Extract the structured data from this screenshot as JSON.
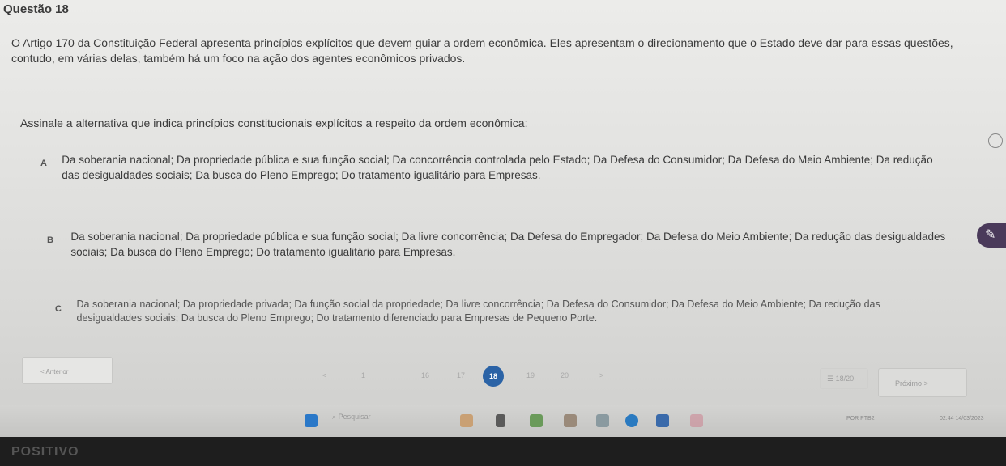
{
  "question": {
    "title": "Questão 18",
    "statement": "O Artigo 170 da Constituição Federal apresenta princípios explícitos que devem guiar a ordem econômica. Eles apresentam o direcionamento que o Estado deve dar para essas questões, contudo, em várias delas, também há um foco na ação dos agentes econômicos privados.",
    "instruction": "Assinale a alternativa que indica princípios constitucionais explícitos a respeito da ordem econômica:"
  },
  "options": [
    {
      "letter": "A",
      "text": "Da soberania nacional; Da propriedade pública e sua função social; Da concorrência controlada pelo Estado; Da Defesa do Consumidor; Da Defesa do Meio Ambiente; Da redução das desigualdades sociais; Da busca do Pleno Emprego; Do tratamento igualitário para Empresas."
    },
    {
      "letter": "B",
      "text": "Da soberania nacional; Da propriedade pública e sua função social; Da livre concorrência; Da Defesa do Empregador; Da Defesa do Meio Ambiente; Da redução das desigualdades sociais; Da busca do Pleno Emprego; Do tratamento igualitário para Empresas."
    },
    {
      "letter": "C",
      "text": "Da soberania nacional; Da propriedade privada; Da função social da propriedade; Da livre concorrência; Da Defesa do Consumidor; Da Defesa do Meio Ambiente; Da redução das desigualdades sociais; Da busca do Pleno Emprego; Do tratamento diferenciado para Empresas de Pequeno Porte."
    }
  ],
  "navigation": {
    "prev_label": "< Anterior",
    "prev_arrow": "<",
    "pages": [
      "1",
      "16",
      "17",
      "18",
      "19",
      "20"
    ],
    "current_page": "18",
    "next_arrow": ">",
    "progress": "18/20",
    "next_label": "Próximo >"
  },
  "taskbar": {
    "search_placeholder": "Pesquisar",
    "lang": "POR PTB2",
    "clock": "02:44 14/03/2023"
  },
  "bezel": {
    "brand": "POSITIVO"
  },
  "colors": {
    "active_page": "#2b63a6",
    "chat_bubble": "#4a3a5a"
  }
}
